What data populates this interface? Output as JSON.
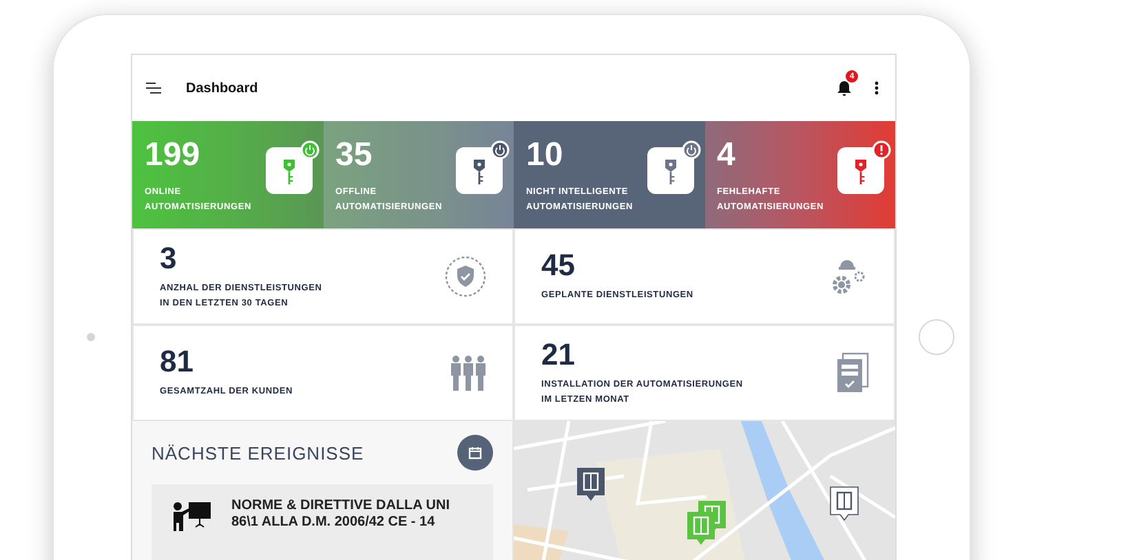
{
  "app_bar": {
    "title": "Dashboard",
    "notification_count": "4"
  },
  "status_tiles": [
    {
      "kind": "online",
      "value": "199",
      "label_lines": [
        "ONLINE",
        "AUTOMATISIERUNGEN"
      ]
    },
    {
      "kind": "offline",
      "value": "35",
      "label_lines": [
        "OFFLINE",
        "AUTOMATISIERUNGEN"
      ]
    },
    {
      "kind": "not_smart",
      "value": "10",
      "label_lines": [
        "NICHT INTELLIGENTE",
        "AUTOMATISIERUNGEN"
      ]
    },
    {
      "kind": "faulty",
      "value": "4",
      "label_lines": [
        "FEHLEHAFTE",
        "AUTOMATISIERUNGEN"
      ]
    }
  ],
  "stat_cards": [
    {
      "kind": "services",
      "value": "3",
      "label_lines": [
        "ANZHAL DER DIENSTLEISTUNGEN",
        "IN DEN LETZTEN 30 TAGEN"
      ]
    },
    {
      "kind": "planned",
      "value": "45",
      "label_lines": [
        "GEPLANTE DIENSTLEISTUNGEN"
      ]
    },
    {
      "kind": "customers",
      "value": "81",
      "label_lines": [
        "GESAMTZAHL DER KUNDEN"
      ]
    },
    {
      "kind": "installations",
      "value": "21",
      "label_lines": [
        "INSTALLATION DER AUTOMATISIERUNGEN",
        "IM LETZEN MONAT"
      ]
    }
  ],
  "events": {
    "title": "NÄCHSTE EREIGNISSE",
    "items": [
      {
        "title": "NORME & DIRETTIVE DALLA UNI 86\\1 ALLA D.M. 2006/42 CE - 14"
      }
    ]
  },
  "map": {
    "pins": [
      {
        "kind": "offline"
      },
      {
        "kind": "online"
      },
      {
        "kind": "online"
      },
      {
        "kind": "not_smart"
      }
    ]
  }
}
